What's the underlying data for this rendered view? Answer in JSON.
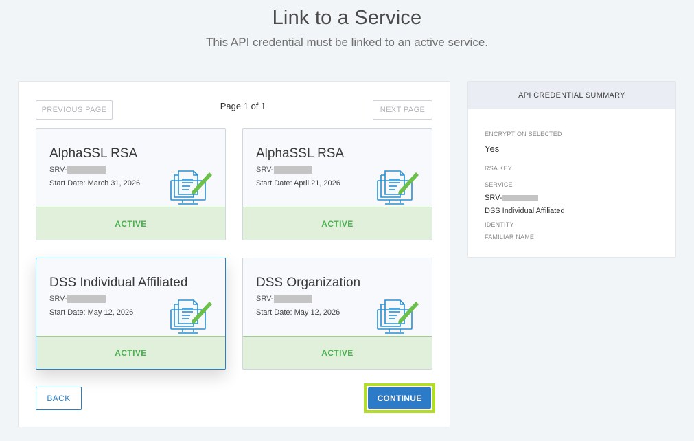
{
  "header": {
    "title": "Link to a Service",
    "subtitle": "This API credential must be linked to an active service."
  },
  "pagination": {
    "previous_label": "PREVIOUS PAGE",
    "next_label": "NEXT PAGE",
    "info": "Page 1 of 1"
  },
  "services": [
    {
      "name": "AlphaSSL RSA",
      "srv_prefix": "SRV-",
      "start_date": "Start Date: March 31, 2026",
      "status": "ACTIVE"
    },
    {
      "name": "AlphaSSL RSA",
      "srv_prefix": "SRV-",
      "start_date": "Start Date: April 21, 2026",
      "status": "ACTIVE"
    },
    {
      "name": "DSS Individual Affiliated",
      "srv_prefix": "SRV-",
      "start_date": "Start Date: May 12, 2026",
      "status": "ACTIVE",
      "selected": true
    },
    {
      "name": "DSS Organization",
      "srv_prefix": "SRV-",
      "start_date": "Start Date: May 12, 2026",
      "status": "ACTIVE"
    }
  ],
  "actions": {
    "back_label": "BACK",
    "continue_label": "CONTINUE"
  },
  "summary": {
    "title": "API CREDENTIAL SUMMARY",
    "encryption_label": "ENCRYPTION SELECTED",
    "encryption_value": "Yes",
    "rsa_key_label": "RSA KEY",
    "service_label": "SERVICE",
    "service_srv_prefix": "SRV-",
    "service_name": "DSS Individual Affiliated",
    "identity_label": "IDENTITY",
    "familiar_name_label": "FAMILIAR NAME"
  },
  "colors": {
    "primary": "#2c7bc8",
    "active_bg": "#e0f0db",
    "active_text": "#4caf50",
    "highlight": "#b2de2a",
    "icon_blue": "#2a8fd0",
    "icon_green": "#6cc04a"
  },
  "icons": {
    "card_icon": "document-edit-monitor-icon"
  }
}
